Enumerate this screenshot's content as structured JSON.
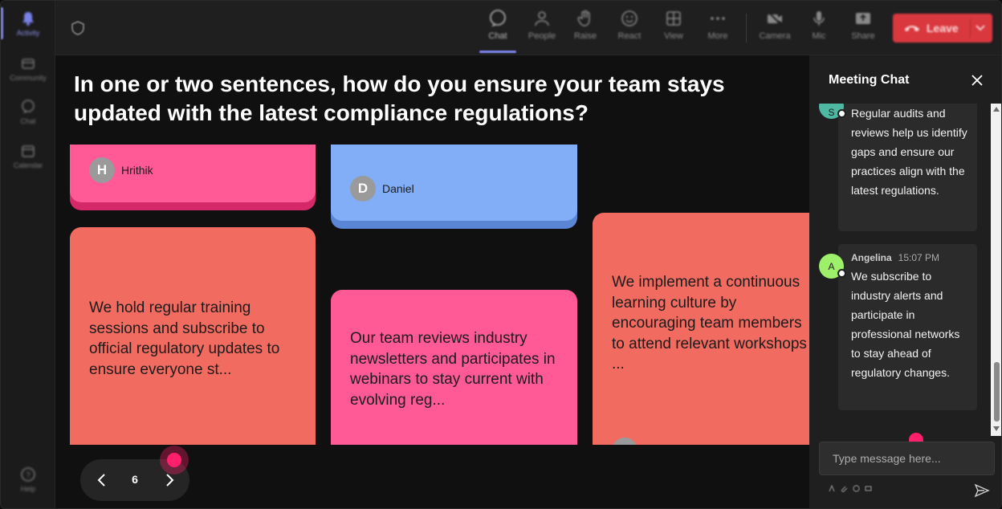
{
  "rail": {
    "items": [
      {
        "label": "Activity"
      },
      {
        "label": "Community"
      },
      {
        "label": "Chat"
      },
      {
        "label": "Calendar"
      },
      {
        "label": "Help"
      }
    ]
  },
  "toolbar": {
    "items": [
      {
        "label": "Chat",
        "icon": "chat-icon"
      },
      {
        "label": "People",
        "icon": "people-icon"
      },
      {
        "label": "Raise",
        "icon": "raise-hand-icon"
      },
      {
        "label": "React",
        "icon": "react-icon"
      },
      {
        "label": "View",
        "icon": "view-grid-icon"
      },
      {
        "label": "More",
        "icon": "more-icon"
      },
      {
        "label": "Camera",
        "icon": "camera-off-icon"
      },
      {
        "label": "Mic",
        "icon": "mic-icon"
      },
      {
        "label": "Share",
        "icon": "share-icon"
      }
    ],
    "leave_label": "Leave",
    "leave_color": "#d9383f"
  },
  "stage": {
    "question": "In one or two sentences, how do you ensure your team stays updated with the latest compliance regulations?",
    "cards": [
      {
        "author": "Hrithik",
        "initial": "H",
        "color": "#ff5a96"
      },
      {
        "author": "Daniel",
        "initial": "D",
        "color": "#81aef7"
      },
      {
        "text": "We hold regular training sessions and subscribe to official regulatory updates to ensure everyone st...",
        "color": "#f26b60"
      },
      {
        "text": "Our team reviews industry newsletters and participates in webinars to stay current with evolving reg...",
        "color": "#ff5a96"
      },
      {
        "text": "We implement a continuous learning culture by encouraging team members to attend relevant workshops ...",
        "color": "#f26b60"
      }
    ],
    "pager": {
      "page": "6"
    }
  },
  "chat": {
    "title": "Meeting Chat",
    "messages": [
      {
        "initial": "S",
        "avatar_color": "#4fb8a2",
        "text": "Regular audits and reviews help us identify gaps and ensure our practices align with the latest regulations."
      },
      {
        "initial": "A",
        "avatar_color": "#9ef06a",
        "author": "Angelina",
        "time": "15:07 PM",
        "text": "We subscribe to industry alerts and participate in professional networks to stay ahead of regulatory changes."
      }
    ],
    "input_placeholder": "Type message here..."
  },
  "accent_cursor_color": "#ff1f6a"
}
